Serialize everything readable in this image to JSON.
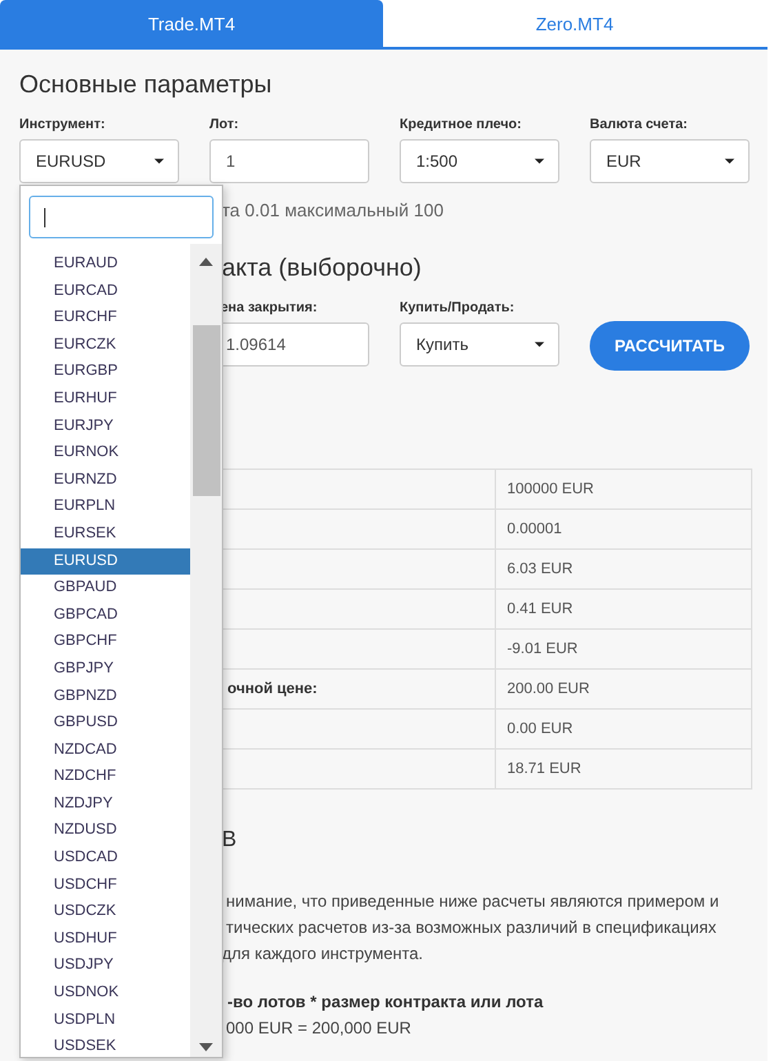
{
  "tabs": [
    {
      "label": "Trade.MT4",
      "selected": true
    },
    {
      "label": "Zero.MT4",
      "selected": false
    }
  ],
  "main_section": {
    "heading": "Основные параметры",
    "fields": [
      {
        "label": "Инструмент:",
        "kind": "select",
        "value": "EURUSD"
      },
      {
        "label": "Лот:",
        "kind": "input",
        "value": "1"
      },
      {
        "label": "Кредитное плечо:",
        "kind": "select",
        "value": "1:500"
      },
      {
        "label": "Валюта счета:",
        "kind": "select",
        "value": "EUR"
      }
    ],
    "hint": "та 0.01 максимальный 100"
  },
  "contract_section": {
    "heading": "акта (выборочно)",
    "fields": [
      {
        "label": "ена закрытия:",
        "kind": "input",
        "value": "1.09614"
      },
      {
        "label": "Купить/Продать:",
        "kind": "select",
        "value": "Купить"
      }
    ],
    "calculate_button": "РАССЧИТАТЬ"
  },
  "results": [
    {
      "value": "100000 EUR"
    },
    {
      "value": "0.00001"
    },
    {
      "value": "6.03 EUR"
    },
    {
      "value": "0.41 EUR"
    },
    {
      "value": "-9.01 EUR"
    },
    {
      "label": "очной цене:",
      "value": "200.00 EUR"
    },
    {
      "value": "0.00 EUR"
    },
    {
      "value": "18.71 EUR"
    }
  ],
  "examples": {
    "heading": "В",
    "paragraph_lines": [
      "нимание, что приведенные ниже расчеты являются примером и",
      "тических расчетов из-за возможных различий в спецификациях",
      "для каждого инструмента."
    ],
    "formula": "-во лотов * размер контракта или лота",
    "calculation": "000 EUR = 200,000 EUR"
  },
  "dropdown": {
    "items": [
      {
        "label": "EURAUD",
        "selected": false
      },
      {
        "label": "EURCAD",
        "selected": false
      },
      {
        "label": "EURCHF",
        "selected": false
      },
      {
        "label": "EURCZK",
        "selected": false
      },
      {
        "label": "EURGBP",
        "selected": false
      },
      {
        "label": "EURHUF",
        "selected": false
      },
      {
        "label": "EURJPY",
        "selected": false
      },
      {
        "label": "EURNOK",
        "selected": false
      },
      {
        "label": "EURNZD",
        "selected": false
      },
      {
        "label": "EURPLN",
        "selected": false
      },
      {
        "label": "EURSEK",
        "selected": false
      },
      {
        "label": "EURUSD",
        "selected": true
      },
      {
        "label": "GBPAUD",
        "selected": false
      },
      {
        "label": "GBPCAD",
        "selected": false
      },
      {
        "label": "GBPCHF",
        "selected": false
      },
      {
        "label": "GBPJPY",
        "selected": false
      },
      {
        "label": "GBPNZD",
        "selected": false
      },
      {
        "label": "GBPUSD",
        "selected": false
      },
      {
        "label": "NZDCAD",
        "selected": false
      },
      {
        "label": "NZDCHF",
        "selected": false
      },
      {
        "label": "NZDJPY",
        "selected": false
      },
      {
        "label": "NZDUSD",
        "selected": false
      },
      {
        "label": "USDCAD",
        "selected": false
      },
      {
        "label": "USDCHF",
        "selected": false
      },
      {
        "label": "USDCZK",
        "selected": false
      },
      {
        "label": "USDHUF",
        "selected": false
      },
      {
        "label": "USDJPY",
        "selected": false
      },
      {
        "label": "USDNOK",
        "selected": false
      },
      {
        "label": "USDPLN",
        "selected": false
      },
      {
        "label": "USDSEK",
        "selected": false
      }
    ]
  }
}
